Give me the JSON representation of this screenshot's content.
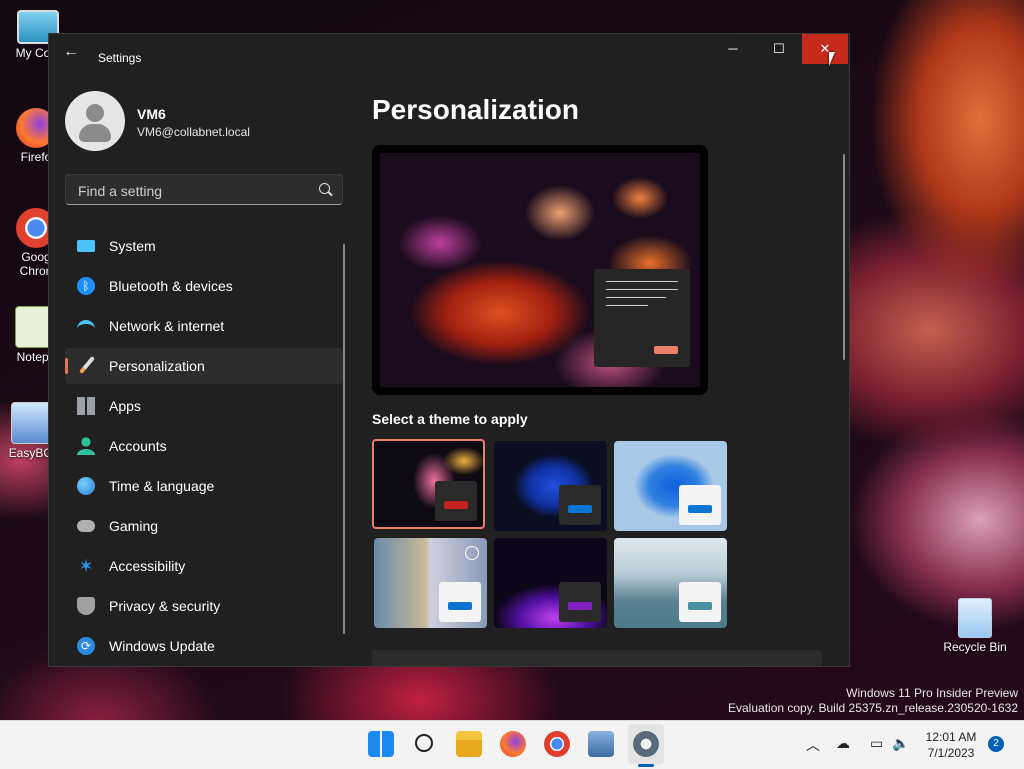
{
  "desktop": {
    "icons": [
      {
        "label": "My Com",
        "icon": "computer-icon"
      },
      {
        "label": "Firefo",
        "icon": "firefox-icon"
      },
      {
        "label": "Goog\nChron",
        "icon": "chrome-icon"
      },
      {
        "label": "Notepa",
        "icon": "notepad-icon"
      },
      {
        "label": "EasyBCI",
        "icon": "easybcd-icon"
      },
      {
        "label": "Recycle Bin",
        "icon": "recycle-bin-icon"
      }
    ],
    "watermark_line1": "Windows 11 Pro Insider Preview",
    "watermark_line2": "Evaluation copy. Build 25375.zn_release.230520-1632"
  },
  "window": {
    "title": "Settings",
    "controls": {
      "minimize": "─",
      "maximize": "☐",
      "close": "✕"
    }
  },
  "user": {
    "name": "VM6",
    "email": "VM6@collabnet.local"
  },
  "search": {
    "placeholder": "Find a setting"
  },
  "nav": [
    {
      "label": "System",
      "icon": "system-icon",
      "color": "#4cc2ff"
    },
    {
      "label": "Bluetooth & devices",
      "icon": "bluetooth-icon",
      "color": "#1f8fff"
    },
    {
      "label": "Network & internet",
      "icon": "wifi-icon",
      "color": "#4cc2ff"
    },
    {
      "label": "Personalization",
      "icon": "paintbrush-icon",
      "color": "#f0a050",
      "active": true
    },
    {
      "label": "Apps",
      "icon": "apps-icon",
      "color": "#9aa0a8"
    },
    {
      "label": "Accounts",
      "icon": "accounts-icon",
      "color": "#2fbf9a"
    },
    {
      "label": "Time & language",
      "icon": "globe-clock-icon",
      "color": "#3aa0f0"
    },
    {
      "label": "Gaming",
      "icon": "gamepad-icon",
      "color": "#b0b0b0"
    },
    {
      "label": "Accessibility",
      "icon": "accessibility-icon",
      "color": "#2a9af0"
    },
    {
      "label": "Privacy & security",
      "icon": "shield-icon",
      "color": "#a0a0a0"
    },
    {
      "label": "Windows Update",
      "icon": "update-icon",
      "color": "#2a8ae0"
    }
  ],
  "main": {
    "page_title": "Personalization",
    "themes_heading": "Select a theme to apply",
    "themes": [
      {
        "name": "theme-bloom-dark",
        "accent": "#c42020",
        "box": "#2a2a2a",
        "selected": true
      },
      {
        "name": "theme-windows-dark",
        "accent": "#0a74d0",
        "box": "#2a2a2a"
      },
      {
        "name": "theme-windows-light",
        "accent": "#0a74d0",
        "box": "#f4f4f4"
      },
      {
        "name": "theme-spotlight",
        "accent": "#0a74d0",
        "box": "#f4f4f4"
      },
      {
        "name": "theme-glow",
        "accent": "#8020c0",
        "box": "#2a2a2a"
      },
      {
        "name": "theme-flow",
        "accent": "#4a90a0",
        "box": "#f4f4f4"
      }
    ]
  },
  "taskbar": {
    "apps": [
      "start-icon",
      "search-icon",
      "file-explorer-icon",
      "firefox-icon",
      "chrome-icon",
      "network-app-icon",
      "settings-icon"
    ],
    "time": "12:01 AM",
    "date": "7/1/2023",
    "notification_count": "2"
  }
}
